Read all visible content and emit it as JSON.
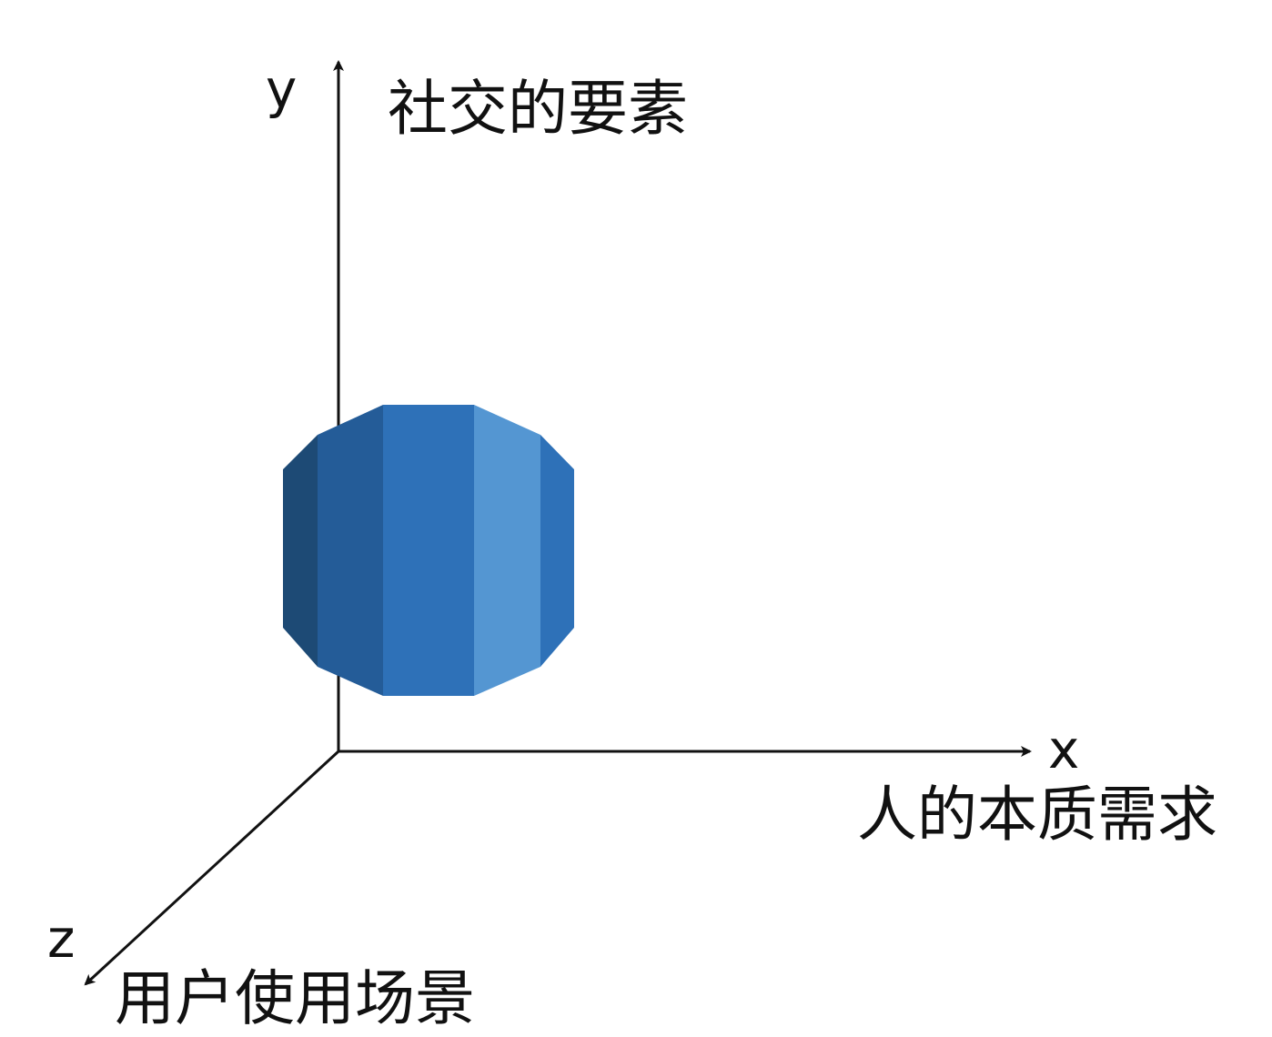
{
  "axes": {
    "y": {
      "letter": "y",
      "label": "社交的要素"
    },
    "x": {
      "letter": "x",
      "label": "人的本质需求"
    },
    "z": {
      "letter": "z",
      "label": "用户使用场景"
    }
  },
  "icon": {
    "name": "database-cylinder-icon",
    "colors": {
      "darkest": "#1D4A75",
      "dark": "#245C98",
      "mid": "#2E71B8",
      "light": "#5496D2"
    }
  },
  "colors": {
    "line": "#111111",
    "text": "#111111",
    "background": "#ffffff"
  }
}
